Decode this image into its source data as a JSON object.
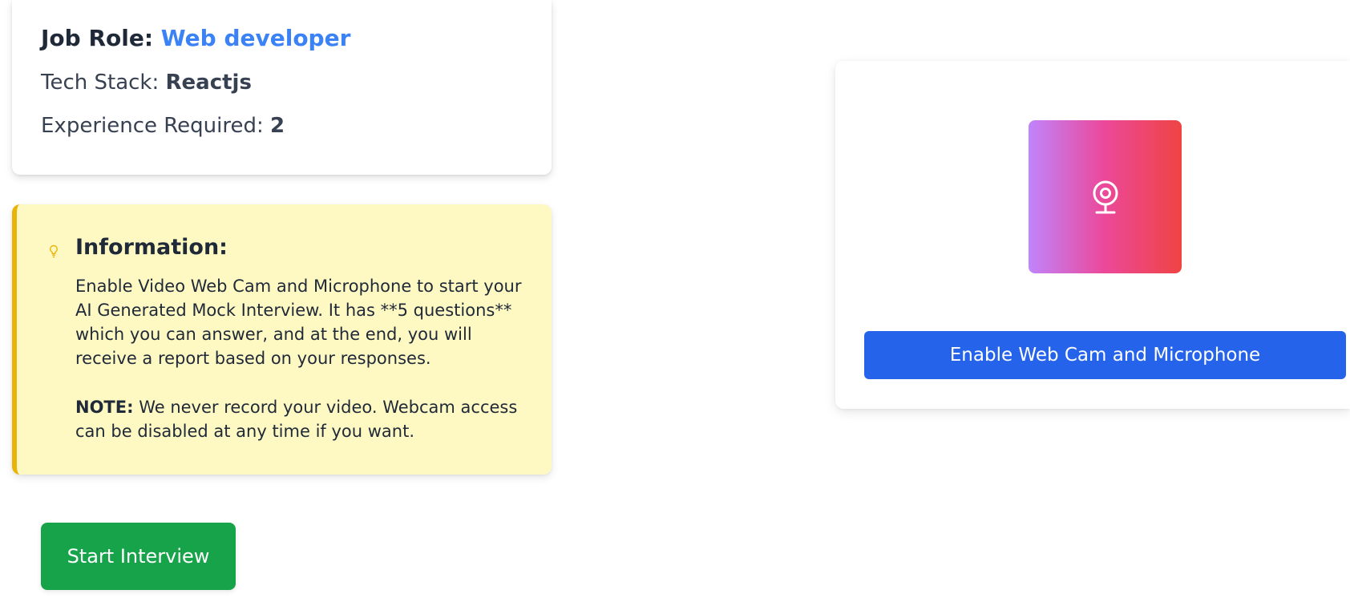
{
  "job": {
    "role_label": "Job Role:",
    "role_value": "Web developer",
    "tech_label": "Tech Stack:",
    "tech_value": "Reactjs",
    "experience_label": "Experience Required:",
    "experience_value": "2"
  },
  "info": {
    "icon": "lightbulb-icon",
    "title": "Information:",
    "body": "Enable Video Web Cam and Microphone to start your AI Generated Mock Interview. It has **5 questions** which you can answer, and at the end, you will receive a report based on your responses.",
    "note_label": "NOTE:",
    "note_text": "We never record your video. Webcam access can be disabled at any time if you want."
  },
  "actions": {
    "start_label": "Start Interview",
    "enable_label": "Enable Web Cam and Microphone"
  },
  "webcam": {
    "icon": "webcam-icon"
  },
  "colors": {
    "accent_blue": "#3b82f6",
    "start_green": "#16a34a",
    "enable_blue": "#2563eb",
    "info_bg": "#fef9c3",
    "info_border": "#eab308",
    "gradient": [
      "#c084fc",
      "#ec4899",
      "#ef4444"
    ]
  }
}
